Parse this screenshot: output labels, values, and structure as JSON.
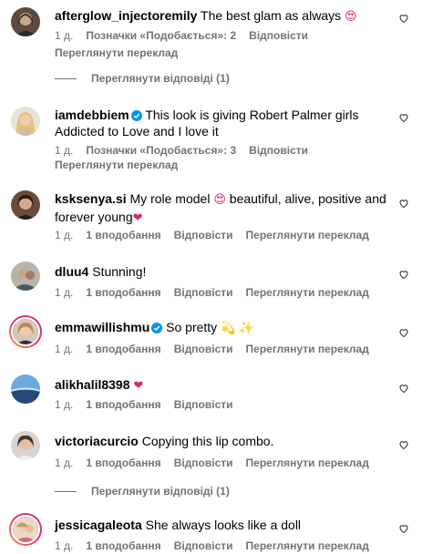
{
  "comments": [
    {
      "username": "afterglow_injectoremily",
      "text": "The best glam as always",
      "emoji": "😍",
      "time": "1 д.",
      "likes": "Позначки «Подобається»: 2",
      "reply": "Відповісти",
      "translate": "Переглянути переклад",
      "view_replies": "Переглянути відповіді (1)"
    },
    {
      "username": "iamdebbiem",
      "verified": true,
      "text": "This look is giving Robert Palmer girls Addicted to Love and I love it",
      "time": "1 д.",
      "likes": "Позначки «Подобається»: 3",
      "reply": "Відповісти",
      "translate": "Переглянути переклад"
    },
    {
      "username": "ksksenya.si",
      "text": "My role model",
      "emoji": "😍",
      "text2": "beautiful, alive, positive and forever young",
      "emoji2": "❤",
      "time": "1 д.",
      "likes": "1 вподобання",
      "reply": "Відповісти",
      "translate": "Переглянути переклад"
    },
    {
      "username": "dluu4",
      "text": "Stunning!",
      "time": "1 д.",
      "likes": "1 вподобання",
      "reply": "Відповісти",
      "translate": "Переглянути переклад"
    },
    {
      "username": "emmawillishmu",
      "verified": true,
      "text": "So pretty",
      "emoji": "💫 ✨",
      "time": "1 д.",
      "likes": "1 вподобання",
      "reply": "Відповісти",
      "translate": "Переглянути переклад"
    },
    {
      "username": "alikhalil8398",
      "emoji": "❤",
      "time": "1 д.",
      "likes": "1 вподобання",
      "reply": "Відповісти"
    },
    {
      "username": "victoriacurcio",
      "text": "Copying this lip combo.",
      "time": "1 д.",
      "likes": "1 вподобання",
      "reply": "Відповісти",
      "translate": "Переглянути переклад",
      "view_replies": "Переглянути відповіді (1)"
    },
    {
      "username": "jessicagaleota",
      "text": "She always looks like a doll",
      "time": "1 д.",
      "likes": "1 вподобання",
      "reply": "Відповісти",
      "translate": "Переглянути переклад"
    }
  ]
}
